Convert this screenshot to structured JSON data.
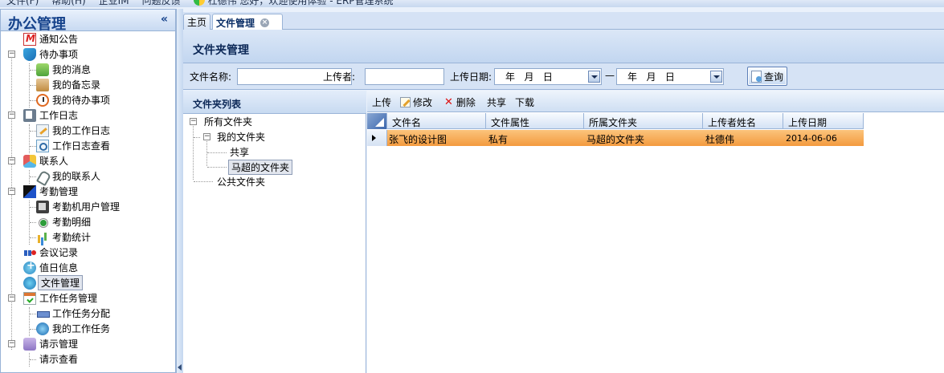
{
  "menubar": {
    "items": [
      "文件(F)",
      "帮助(H)",
      "企业IM",
      "问题反馈"
    ],
    "user_greeting": "杜德伟 您好，欢迎使用体验 - ERP管理系统"
  },
  "nav": {
    "title": "办公管理",
    "collapse_glyph": "«",
    "items": [
      {
        "label": "通知公告",
        "icon": "mail-icon"
      },
      {
        "label": "待办事项",
        "icon": "shield-icon",
        "children": [
          {
            "label": "我的消息",
            "icon": "message-icon"
          },
          {
            "label": "我的备忘录",
            "icon": "memo-icon"
          },
          {
            "label": "我的待办事项",
            "icon": "alarm-clock-icon"
          }
        ]
      },
      {
        "label": "工作日志",
        "icon": "journal-icon",
        "children": [
          {
            "label": "我的工作日志",
            "icon": "edit-log-icon"
          },
          {
            "label": "工作日志查看",
            "icon": "view-log-icon"
          }
        ]
      },
      {
        "label": "联系人",
        "icon": "contacts-icon",
        "children": [
          {
            "label": "我的联系人",
            "icon": "person-icon"
          }
        ]
      },
      {
        "label": "考勤管理",
        "icon": "attendance-icon",
        "children": [
          {
            "label": "考勤机用户管理",
            "icon": "device-user-icon"
          },
          {
            "label": "考勤明细",
            "icon": "detail-icon"
          },
          {
            "label": "考勤统计",
            "icon": "bar-chart-icon"
          }
        ]
      },
      {
        "label": "会议记录",
        "icon": "meeting-icon"
      },
      {
        "label": "值日信息",
        "icon": "duty-icon"
      },
      {
        "label": "文件管理",
        "icon": "file-manager-icon",
        "selected": true
      },
      {
        "label": "工作任务管理",
        "icon": "task-icon",
        "children": [
          {
            "label": "工作任务分配",
            "icon": "assign-icon"
          },
          {
            "label": "我的工作任务",
            "icon": "my-task-icon"
          }
        ]
      },
      {
        "label": "请示管理",
        "icon": "report-icon",
        "children": [
          {
            "label": "请示查看",
            "icon": ""
          }
        ]
      }
    ]
  },
  "tabs": {
    "home": "主页",
    "active": "文件管理",
    "close_glyph": "×"
  },
  "page": {
    "title": "文件夹管理"
  },
  "search": {
    "filename_label": "文件名称:",
    "filename_value": "",
    "uploader_label": "上传者:",
    "uploader_value": "",
    "date_label": "上传日期:",
    "date_from": "年   月   日",
    "date_to": "年   月   日",
    "range_sep": "—",
    "query_button": "查询"
  },
  "folders": {
    "panel_title": "文件夹列表",
    "root": "所有文件夹",
    "my_folder": "我的文件夹",
    "shared": "共享",
    "selected_folder": "马超的文件夹",
    "public": "公共文件夹"
  },
  "toolbar": {
    "upload": "上传",
    "edit": "修改",
    "delete": "删除",
    "share": "共享",
    "download": "下载"
  },
  "grid": {
    "columns": [
      "文件名",
      "文件属性",
      "所属文件夹",
      "上传者姓名",
      "上传日期"
    ],
    "rows": [
      {
        "name": "张飞的设计图",
        "attr": "私有",
        "folder": "马超的文件夹",
        "uploader": "杜德伟",
        "date": "2014-06-06"
      }
    ],
    "highlight_color": "#f5a44a"
  }
}
